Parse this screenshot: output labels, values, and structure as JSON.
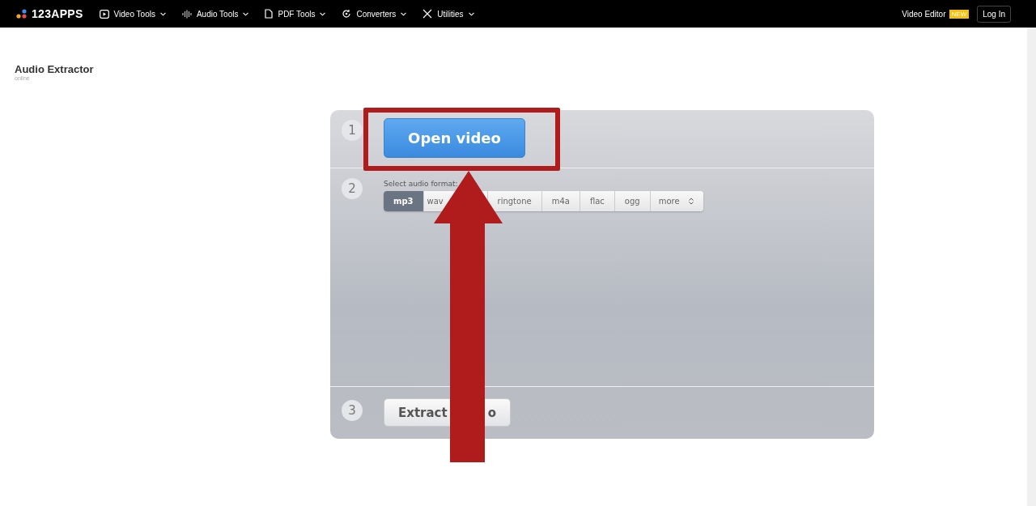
{
  "navbar": {
    "logo": "123APPS",
    "menu": [
      {
        "label": "Video Tools"
      },
      {
        "label": "Audio Tools"
      },
      {
        "label": "PDF Tools"
      },
      {
        "label": "Converters"
      },
      {
        "label": "Utilities"
      }
    ],
    "video_editor": "Video Editor",
    "badge": "NEW",
    "login": "Log In"
  },
  "page": {
    "title": "Audio Extractor",
    "subtitle": "online"
  },
  "steps": [
    {
      "number": "1",
      "open_button": "Open video"
    },
    {
      "number": "2",
      "label": "Select audio format:",
      "formats": [
        {
          "label": "mp3",
          "selected": true
        },
        {
          "label": "wav",
          "selected": false
        },
        {
          "label": "ringtone",
          "selected": false
        },
        {
          "label": "m4a",
          "selected": false
        },
        {
          "label": "flac",
          "selected": false
        },
        {
          "label": "ogg",
          "selected": false
        }
      ],
      "more": "more"
    },
    {
      "number": "3",
      "extract_parts": [
        "Extract",
        "o"
      ]
    }
  ],
  "annotation": {
    "highlight_box": true,
    "arrow": true
  }
}
